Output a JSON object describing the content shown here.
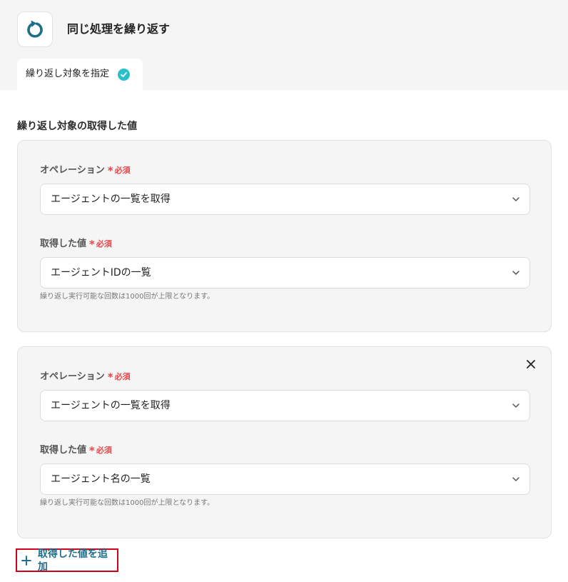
{
  "header": {
    "title": "同じ処理を繰り返す",
    "icon": "repeat-icon",
    "accent_color": "#1e6e8a"
  },
  "tabs": [
    {
      "label": "繰り返し対象を指定",
      "status_icon": "check-circle-icon",
      "status_color": "#29c0c9"
    }
  ],
  "section": {
    "title": "繰り返し対象の取得した値"
  },
  "cards": [
    {
      "operation_label": "オペレーション",
      "operation_value": "エージェントの一覧を取得",
      "value_label": "取得した値",
      "value_value": "エージェントIDの一覧",
      "required_mark": "*",
      "required_text": "必須",
      "hint": "繰り返し実行可能な回数は1000回が上限となります。"
    },
    {
      "operation_label": "オペレーション",
      "operation_value": "エージェントの一覧を取得",
      "value_label": "取得した値",
      "value_value": "エージェント名の一覧",
      "required_mark": "*",
      "required_text": "必須",
      "hint": "繰り返し実行可能な回数は1000回が上限となります。",
      "closable": true
    }
  ],
  "add_button": {
    "label": "取得した値を追加",
    "icon": "plus-icon"
  }
}
